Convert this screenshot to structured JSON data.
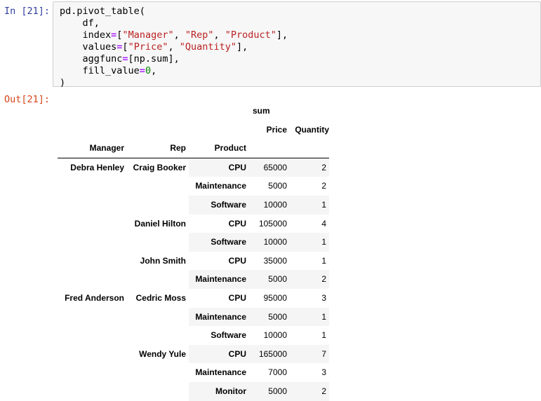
{
  "cell": {
    "in_prompt": "In [21]:",
    "out_prompt": "Out[21]:",
    "code_lines": [
      "pd.pivot_table(",
      "    df,",
      "    index=[\"Manager\", \"Rep\", \"Product\"],",
      "    values=[\"Price\", \"Quantity\"],",
      "    aggfunc=[np.sum],",
      "    fill_value=0,",
      ")"
    ]
  },
  "table": {
    "top_header": "sum",
    "value_columns": [
      "Price",
      "Quantity"
    ],
    "index_names": [
      "Manager",
      "Rep",
      "Product"
    ],
    "rows": [
      {
        "manager": "Debra Henley",
        "rep": "Craig Booker",
        "product": "CPU",
        "price": "65000",
        "quantity": "2"
      },
      {
        "manager": "",
        "rep": "",
        "product": "Maintenance",
        "price": "5000",
        "quantity": "2"
      },
      {
        "manager": "",
        "rep": "",
        "product": "Software",
        "price": "10000",
        "quantity": "1"
      },
      {
        "manager": "",
        "rep": "Daniel Hilton",
        "product": "CPU",
        "price": "105000",
        "quantity": "4"
      },
      {
        "manager": "",
        "rep": "",
        "product": "Software",
        "price": "10000",
        "quantity": "1"
      },
      {
        "manager": "",
        "rep": "John Smith",
        "product": "CPU",
        "price": "35000",
        "quantity": "1"
      },
      {
        "manager": "",
        "rep": "",
        "product": "Maintenance",
        "price": "5000",
        "quantity": "2"
      },
      {
        "manager": "Fred Anderson",
        "rep": "Cedric Moss",
        "product": "CPU",
        "price": "95000",
        "quantity": "3"
      },
      {
        "manager": "",
        "rep": "",
        "product": "Maintenance",
        "price": "5000",
        "quantity": "1"
      },
      {
        "manager": "",
        "rep": "",
        "product": "Software",
        "price": "10000",
        "quantity": "1"
      },
      {
        "manager": "",
        "rep": "Wendy Yule",
        "product": "CPU",
        "price": "165000",
        "quantity": "7"
      },
      {
        "manager": "",
        "rep": "",
        "product": "Maintenance",
        "price": "7000",
        "quantity": "3"
      },
      {
        "manager": "",
        "rep": "",
        "product": "Monitor",
        "price": "5000",
        "quantity": "2"
      }
    ]
  }
}
